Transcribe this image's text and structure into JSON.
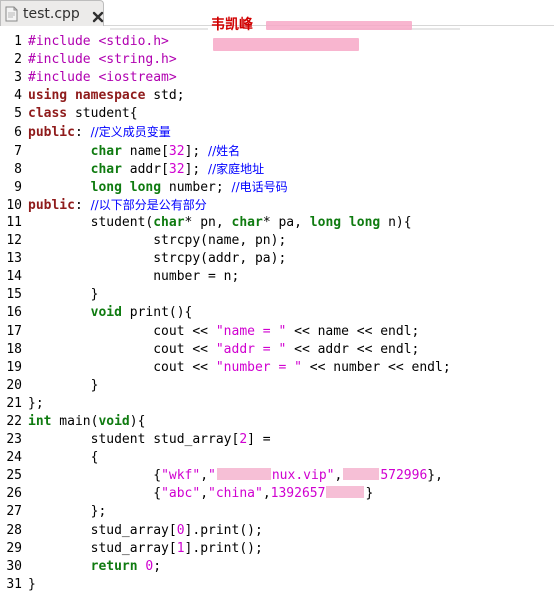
{
  "tab": {
    "file_name": "test.cpp",
    "icon_name": "file-icon",
    "close_icon": "close-icon"
  },
  "header": {
    "name": "韦凯峰"
  },
  "code_lines": [
    "#include <stdio.h>",
    "#include <string.h>",
    "#include <iostream>",
    "using namespace std;",
    "class student{",
    "public: //定义成员变量",
    "        char name[32]; //姓名",
    "        char addr[32]; //家庭地址",
    "        long long number; //电话号码",
    "public: //以下部分是公有部分",
    "        student(char* pn, char* pa, long long n){",
    "                strcpy(name, pn);",
    "                strcpy(addr, pa);",
    "                number = n;",
    "        }",
    "        void print(){",
    "                cout << \"name = \" << name << endl;",
    "                cout << \"addr = \" << addr << endl;",
    "                cout << \"number = \" << number << endl;",
    "        }",
    "};",
    "int main(void){",
    "        student stud_array[2] =",
    "        {",
    "                {\"wkf\",\"nux.vip\",572996},",
    "                {\"abc\",\"china\",1392657},",
    "        };",
    "        stud_array[0].print();",
    "        stud_array[1].print();",
    "        return 0;",
    "}"
  ],
  "line_numbers": [
    "1",
    "2",
    "3",
    "4",
    "5",
    "6",
    "7",
    "8",
    "9",
    "10",
    "11",
    "12",
    "13",
    "14",
    "15",
    "16",
    "17",
    "18",
    "19",
    "20",
    "21",
    "22",
    "23",
    "24",
    "25",
    "26",
    "27",
    "28",
    "29",
    "30",
    "31"
  ],
  "colors": {
    "keyword": "#0f7b10",
    "type_keyword": "#8f1b1b",
    "preprocessor": "#b000b0",
    "string": "#d000d0",
    "comment": "#0000ff",
    "header_red": "#d10000",
    "redaction_pink": "#f5b8d2"
  }
}
